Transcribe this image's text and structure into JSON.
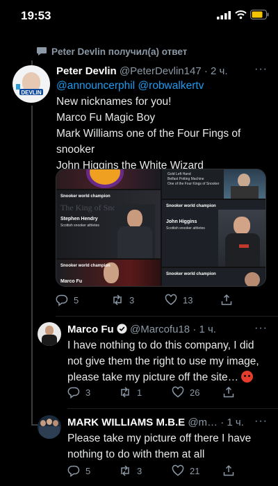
{
  "status_bar": {
    "time": "19:53"
  },
  "reply_context": "Peter Devlin получил(а) ответ",
  "tweets": [
    {
      "name": "Peter Devlin",
      "handle": "@PeterDevlin147",
      "time": "· 2 ч.",
      "avatar_text": "DEVLIN",
      "mentions": "@announcerphil @robwalkertv",
      "lines": [
        "New nicknames for you!",
        "Marco Fu Magic Boy",
        "Mark Williams one of the Four Fings of snooker",
        "John Higgins the White Wizard"
      ],
      "counts": {
        "reply": "5",
        "retweet": "3",
        "like": "13"
      },
      "media": {
        "card1_title": "Snooker world champion",
        "card1_name": "Stephen Hendry",
        "card1_sub": "Scottish snooker athletes",
        "card1_bg_text": "The King of Snooker",
        "card2_title": "Snooker world champion",
        "card2_name": "John Higgins",
        "card2_sub": "Scottish snooker athletes",
        "card3_title": "Snooker world champion",
        "card3_name": "Marco Fu",
        "card4_title": "Snooker world champion",
        "top_right_lines": [
          "Gold Left Hand",
          "Belfast Potting Machine",
          "One of the Four Kings of Snooker"
        ]
      }
    },
    {
      "name": "Marco Fu",
      "handle": "@Marcofu18",
      "time": "· 1 ч.",
      "verified": true,
      "text": "I have nothing to do this company, I did not give them the right to use my image, please take my picture off the site…",
      "counts": {
        "reply": "3",
        "retweet": "1",
        "like": "26"
      }
    },
    {
      "name": "MARK WILLIAMS M.B.E",
      "handle": "@m…",
      "time": "· 1 ч.",
      "text": "Please take my picture off there I have nothing to do with them at all",
      "counts": {
        "reply": "5",
        "retweet": "3",
        "like": "21"
      }
    }
  ],
  "colors": {
    "accent": "#1d9bf0",
    "muted": "#8b98a5",
    "background": "#000000"
  },
  "icons": [
    "reply-icon",
    "retweet-icon",
    "like-icon",
    "share-icon",
    "verified-icon",
    "more-icon"
  ]
}
